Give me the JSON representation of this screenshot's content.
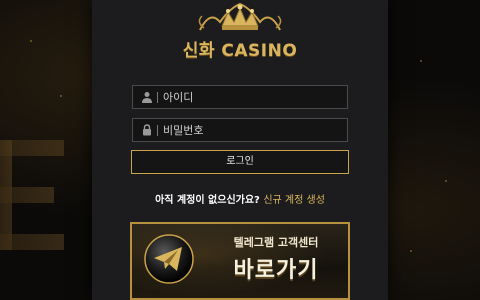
{
  "brand": {
    "name": "신화 CASINO",
    "icon": "crown-icon"
  },
  "login": {
    "username_placeholder": "아이디",
    "password_placeholder": "비밀번호",
    "submit_label": "로그인"
  },
  "signup": {
    "prompt": "아직 계정이 없으신가요?",
    "link_label": "신규 계정 생성"
  },
  "telegram_banner": {
    "line1": "텔레그램 고객센터",
    "line2": "바로가기",
    "icon": "telegram-icon"
  },
  "colors": {
    "accent_gold": "#d9b55e",
    "panel_bg": "#1c1c1e",
    "page_bg": "#0b0a09"
  }
}
